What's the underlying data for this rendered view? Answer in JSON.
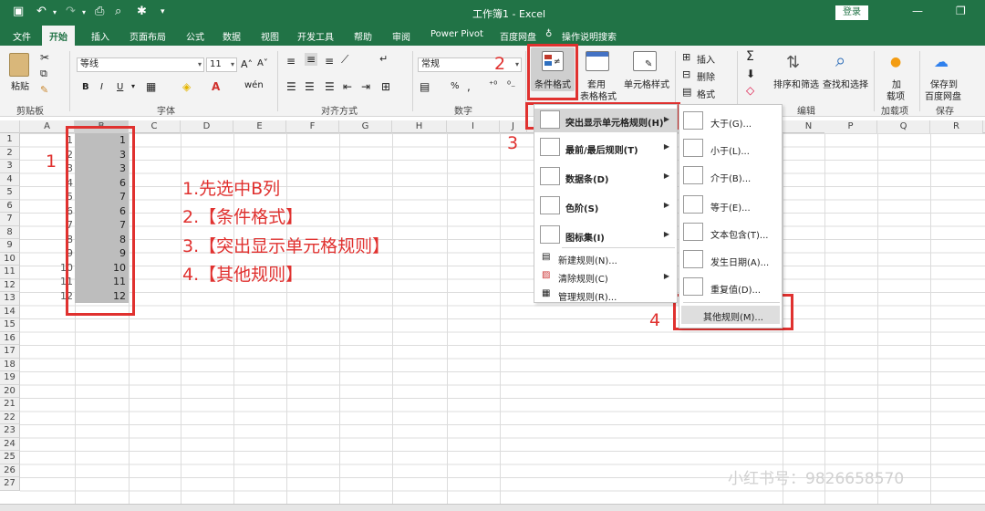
{
  "window": {
    "title": "工作簿1  -  Excel",
    "login": "登录"
  },
  "tabs": [
    "文件",
    "开始",
    "插入",
    "页面布局",
    "公式",
    "数据",
    "视图",
    "开发工具",
    "帮助",
    "Power Pivot",
    "百度网盘",
    "审阅"
  ],
  "tabs_ordered": [
    {
      "label": "文件"
    },
    {
      "label": "开始"
    },
    {
      "label": "插入"
    },
    {
      "label": "页面布局"
    },
    {
      "label": "公式"
    },
    {
      "label": "数据"
    },
    {
      "label": "视图"
    },
    {
      "label": "开发工具"
    },
    {
      "label": "帮助"
    },
    {
      "label": "审阅"
    },
    {
      "label": "Power Pivot"
    },
    {
      "label": "百度网盘"
    }
  ],
  "tell_me": "操作说明搜索",
  "ribbon": {
    "paste": "粘贴",
    "clipboard": "剪贴板",
    "font_name": "等线",
    "font_size": "11",
    "font_group": "字体",
    "bold": "B",
    "italic": "I",
    "underline": "U",
    "wen": "wén",
    "align_group": "对齐方式",
    "number_format": "常规",
    "number_group": "数字",
    "cond_format": "条件格式",
    "table_format_1": "套用",
    "table_format_2": "表格格式",
    "cell_style": "单元格样式",
    "insert": "插入",
    "delete": "删除",
    "format": "格式",
    "sort_filter": "排序和筛选",
    "find_select": "查找和选择",
    "edit_group": "编辑",
    "addin_1": "加",
    "addin_2": "载项",
    "addin_group": "加载项",
    "save_1": "保存到",
    "save_2": "百度网盘",
    "save_group": "保存",
    "percent": "%"
  },
  "columns": [
    "A",
    "B",
    "C",
    "D",
    "E",
    "F",
    "G",
    "H",
    "I",
    "J",
    "K",
    "L",
    "M",
    "N",
    "O",
    "P",
    "Q",
    "R"
  ],
  "rows": [
    "1",
    "2",
    "3",
    "4",
    "5",
    "6",
    "7",
    "8",
    "9",
    "10",
    "11",
    "12",
    "13",
    "14",
    "15",
    "16",
    "17",
    "18",
    "19",
    "20",
    "21",
    "22",
    "23",
    "24",
    "25",
    "26",
    "27"
  ],
  "col_a_partial": [
    "1",
    "2",
    "3",
    "4",
    "5",
    "6",
    "7",
    "8",
    "9",
    "10",
    "11",
    "12"
  ],
  "col_b_values": [
    "1",
    "3",
    "3",
    "6",
    "7",
    "6",
    "7",
    "8",
    "9",
    "10",
    "11",
    "12"
  ],
  "annotations": {
    "num1": "1",
    "num2": "2",
    "num3": "3",
    "num4": "4",
    "step1": "1.先选中B列",
    "step2": "2.【条件格式】",
    "step3": "3.【突出显示单元格规则】",
    "step4": "4.【其他规则】"
  },
  "menu_main": [
    "突出显示单元格规则(H)",
    "最前/最后规则(T)",
    "数据条(D)",
    "色阶(S)",
    "图标集(I)",
    "新建规则(N)...",
    "清除规则(C)",
    "管理规则(R)..."
  ],
  "menu_sub": [
    "大于(G)...",
    "小于(L)...",
    "介于(B)...",
    "等于(E)...",
    "文本包含(T)...",
    "发生日期(A)...",
    "重复值(D)...",
    "其他规则(M)..."
  ],
  "watermark": "小红书号：9826658570",
  "colors": {
    "excel_green": "#217346",
    "annotation_red": "#e0312f",
    "selection_gray": "#bdbdbd"
  }
}
